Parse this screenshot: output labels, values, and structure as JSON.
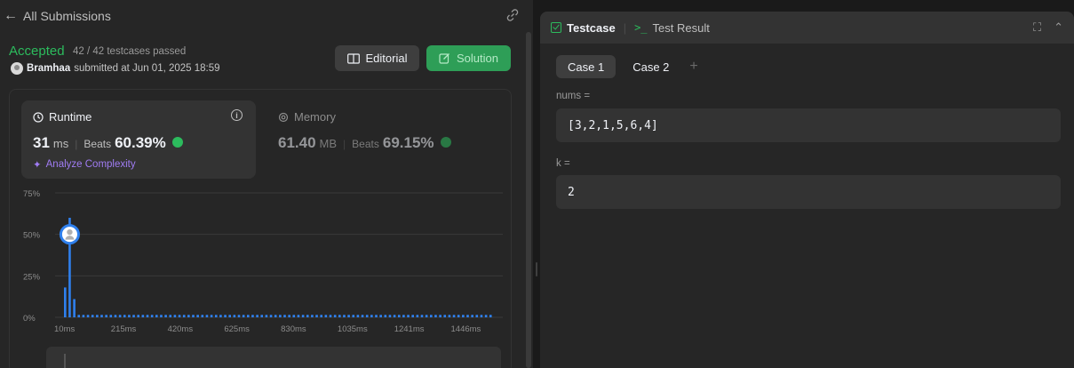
{
  "left_header": {
    "back_label": "All Submissions"
  },
  "submission": {
    "status": "Accepted",
    "testcases": "42 / 42 testcases passed",
    "user": "Bramhaa",
    "submitted_text": "submitted at Jun 01, 2025 18:59"
  },
  "buttons": {
    "editorial": "Editorial",
    "solution": "Solution"
  },
  "runtime": {
    "title": "Runtime",
    "value": "31",
    "unit": "ms",
    "beats_label": "Beats",
    "beats_value": "60.39%",
    "analyze_label": "Analyze Complexity"
  },
  "memory": {
    "title": "Memory",
    "value": "61.40",
    "unit": "MB",
    "beats_label": "Beats",
    "beats_value": "69.15%"
  },
  "chart_data": {
    "type": "bar",
    "title": "",
    "xlabel": "",
    "ylabel": "",
    "ylim": [
      0,
      75
    ],
    "y_ticks": [
      "75%",
      "50%",
      "25%",
      "0%"
    ],
    "y_tick_values": [
      75,
      50,
      25,
      0
    ],
    "x_ticks": [
      "10ms",
      "215ms",
      "420ms",
      "625ms",
      "830ms",
      "1035ms",
      "1241ms",
      "1446ms"
    ],
    "series": [
      {
        "values": [
          18,
          60,
          11,
          1.5,
          1.5,
          1.5,
          1.5,
          1.5,
          1.5,
          1.5,
          1.5,
          1.5,
          1.5,
          1.5,
          1.5,
          1.5,
          1.5,
          1.5,
          1.5,
          1.5,
          1.5,
          1.5,
          1.5,
          1.5,
          1.5,
          1.5,
          1.5,
          1.5,
          1.5,
          1.5,
          1.5,
          1.5,
          1.5,
          1.5,
          1.5,
          1.5,
          1.5,
          1.5,
          1.5,
          1.5,
          1.5,
          1.5,
          1.5,
          1.5,
          1.5,
          1.5,
          1.5,
          1.5,
          1.5,
          1.5,
          1.5,
          1.5,
          1.5,
          1.5,
          1.5,
          1.5,
          1.5,
          1.5,
          1.5,
          1.5,
          1.5,
          1.5,
          1.5,
          1.5,
          1.5,
          1.5,
          1.5,
          1.5,
          1.5,
          1.5,
          1.5,
          1.5,
          1.5,
          1.5,
          1.5,
          1.5,
          1.5,
          1.5,
          1.5,
          1.5,
          1.5,
          1.5,
          1.5,
          1.5,
          1.5,
          1.5,
          1.5,
          1.5,
          1.5,
          1.5,
          1.5,
          1.5,
          1.5,
          1.5
        ]
      }
    ],
    "user_marker_index": 1,
    "user_marker_value": 50,
    "colors": {
      "bar": "#2f80ed",
      "grid": "#3a3a3a",
      "tick": "#8c8c8c"
    }
  },
  "right_panel": {
    "tab_testcase": "Testcase",
    "tab_test_result": "Test Result",
    "cases": [
      "Case 1",
      "Case 2"
    ],
    "add_symbol": "+",
    "fields": [
      {
        "label": "nums =",
        "value": "[3,2,1,5,6,4]"
      },
      {
        "label": "k =",
        "value": "2"
      }
    ]
  },
  "colors": {
    "accent_green": "#2cbb5d",
    "purple": "#a07cf3",
    "bg": "#262626"
  }
}
